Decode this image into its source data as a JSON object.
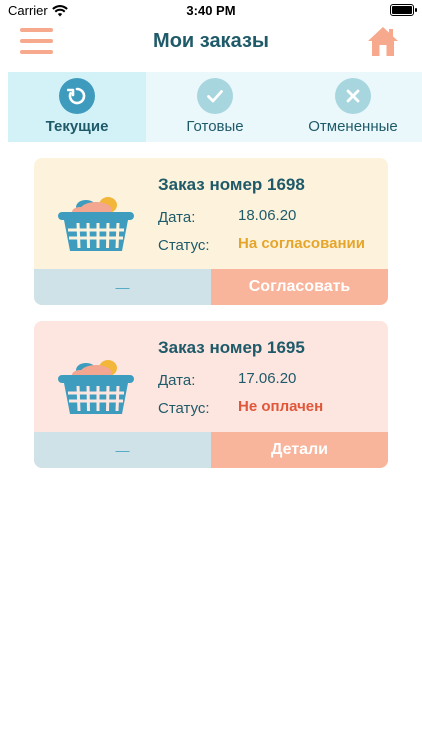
{
  "status_bar": {
    "carrier": "Carrier",
    "time": "3:40 PM"
  },
  "header": {
    "title": "Мои заказы"
  },
  "tabs": [
    {
      "label": "Текущие",
      "icon": "refresh-icon",
      "active": true
    },
    {
      "label": "Готовые",
      "icon": "check-icon",
      "active": false
    },
    {
      "label": "Отмененные",
      "icon": "close-icon",
      "active": false
    }
  ],
  "orders": [
    {
      "title": "Заказ номер 1698",
      "date_label": "Дата:",
      "date": "18.06.20",
      "status_label": "Статус:",
      "status": "На согласовании",
      "status_color": "#e5a52a",
      "left_text": "—",
      "action": "Согласовать"
    },
    {
      "title": "Заказ номер 1695",
      "date_label": "Дата:",
      "date": "17.06.20",
      "status_label": "Статус:",
      "status": "Не оплачен",
      "status_color": "#e1573a",
      "left_text": "—",
      "action": "Детали"
    }
  ],
  "colors": {
    "accent": "#f7a98d",
    "primary_text": "#1f5a69",
    "tab_active_bg": "#d2f2f8",
    "tab_bg": "#eaf8fb"
  }
}
